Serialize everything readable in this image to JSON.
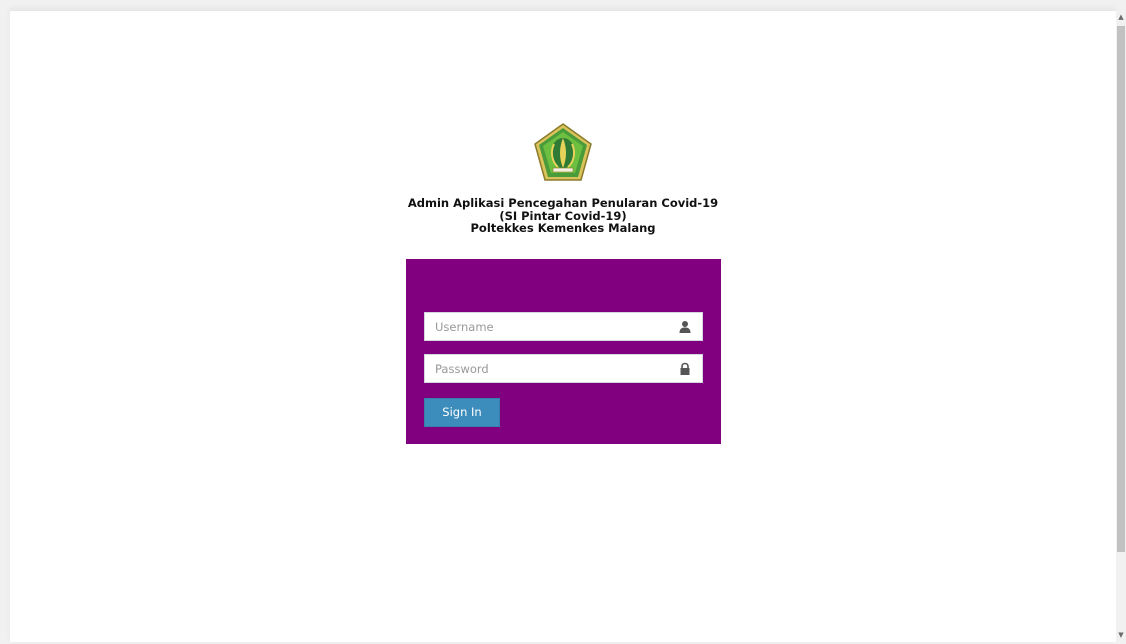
{
  "header": {
    "title_line1": "Admin Aplikasi Pencegahan Penularan Covid-19",
    "title_line2": "(SI Pintar Covid-19)",
    "title_line3": "Poltekkes Kemenkes Malang"
  },
  "login": {
    "username_placeholder": "Username",
    "username_value": "",
    "password_placeholder": "Password",
    "password_value": "",
    "submit_label": "Sign In"
  },
  "icons": {
    "logo": "institution-emblem-icon",
    "username": "user-icon",
    "password": "lock-icon"
  },
  "colors": {
    "login_box_bg": "#800080",
    "button_bg": "#3c8dbc",
    "page_bg": "#ffffff"
  }
}
